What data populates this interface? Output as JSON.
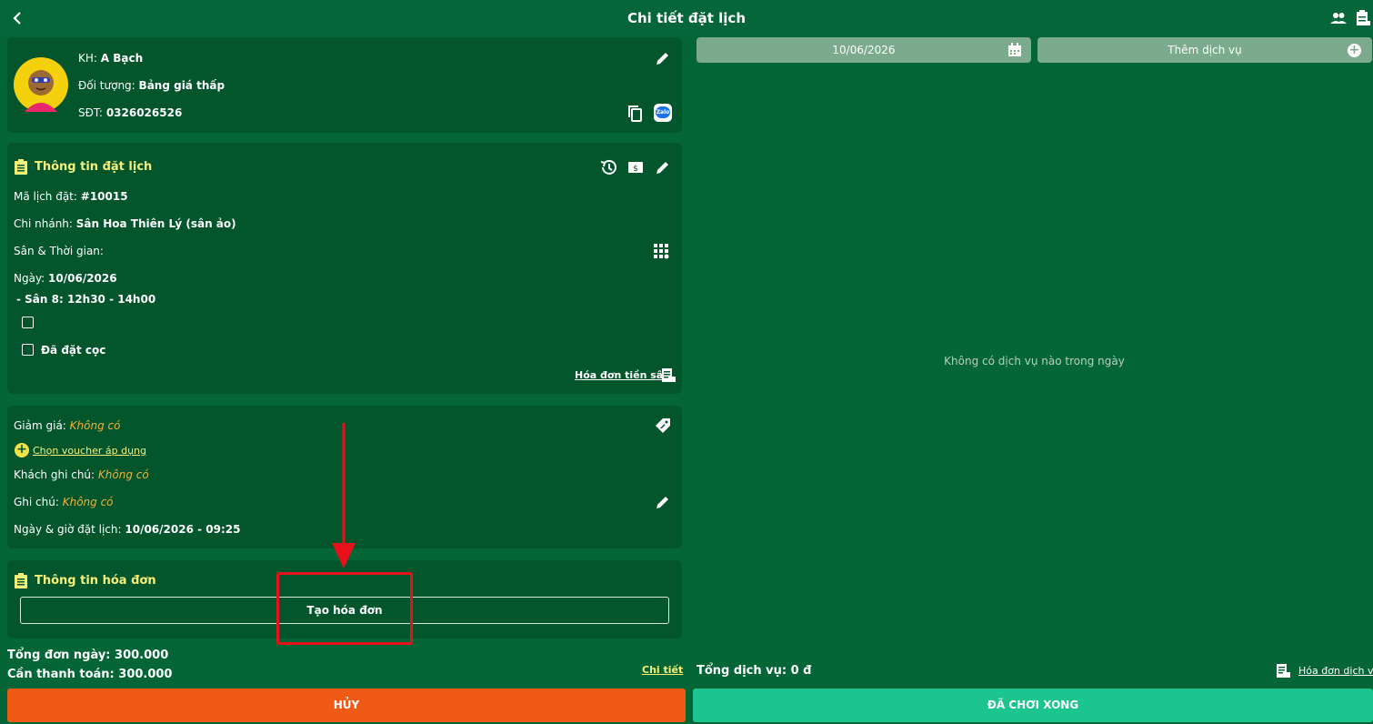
{
  "header": {
    "title": "Chi tiết đặt lịch"
  },
  "customer": {
    "name_label": "KH:",
    "name": "A Bạch",
    "group_label": "Đối tượng:",
    "group": "Bảng giá thấp",
    "phone_label": "SĐT:",
    "phone": "0326026526",
    "zalo_text": "Zalo"
  },
  "booking": {
    "section_title": "Thông tin đặt lịch",
    "code_label": "Mã lịch đặt:",
    "code": "#10015",
    "branch_label": "Chi nhánh:",
    "branch": "Sân Hoa Thiên Lý (sân ảo)",
    "court_time_label": "Sân & Thời gian:",
    "date_label": "Ngày:",
    "date": "10/06/2026",
    "slot": "- Sân 8: 12h30 - 14h00",
    "deposit_label": "Đã đặt cọc",
    "court_invoice_link": "Hóa đơn tiền sân"
  },
  "extras": {
    "discount_label": "Giảm giá:",
    "discount_value": "Không có",
    "voucher_link": "Chọn voucher áp dụng",
    "customer_note_label": "Khách ghi chú:",
    "customer_note_value": "Không có",
    "note_label": "Ghi chú:",
    "note_value": "Không có",
    "booked_at_label": "Ngày & giờ đặt lịch:",
    "booked_at": "10/06/2026 - 09:25"
  },
  "invoice": {
    "section_title": "Thông tin hóa đơn",
    "create_button": "Tạo hóa đơn"
  },
  "totals": {
    "day_total": "Tổng đơn ngày: 300.000",
    "to_pay": "Cần thanh toán: 300.000",
    "detail_link": "Chi tiết"
  },
  "right_panel": {
    "date_pill": "10/06/2026",
    "add_service": "Thêm dịch vụ",
    "empty_text": "Không có dịch vụ nào trong ngày",
    "service_total": "Tổng dịch vụ: 0 đ",
    "service_invoice_link": "Hóa đơn dịch vụ"
  },
  "buttons": {
    "cancel": "HỦY",
    "done": "ĐÃ CHƠI XONG"
  },
  "colors": {
    "background": "#046637",
    "card": "#03552c",
    "cancel": "#ef5a17",
    "done": "#1cc48e",
    "annotation": "#e8111b",
    "section_title": "#f6ef7a"
  }
}
